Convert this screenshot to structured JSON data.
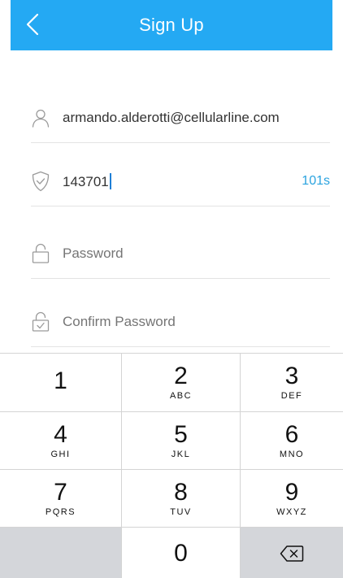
{
  "header": {
    "title": "Sign Up",
    "background": "#24a9f3"
  },
  "form": {
    "email": {
      "value": "armando.alderotti@cellularline.com"
    },
    "code": {
      "value": "143701",
      "timer": "101s",
      "timer_color": "#2aa3df"
    },
    "password": {
      "placeholder": "Password"
    },
    "confirm_password": {
      "placeholder": "Confirm Password"
    }
  },
  "keypad": {
    "keys": [
      {
        "digit": "1",
        "letters": ""
      },
      {
        "digit": "2",
        "letters": "ABC"
      },
      {
        "digit": "3",
        "letters": "DEF"
      },
      {
        "digit": "4",
        "letters": "GHI"
      },
      {
        "digit": "5",
        "letters": "JKL"
      },
      {
        "digit": "6",
        "letters": "MNO"
      },
      {
        "digit": "7",
        "letters": "PQRS"
      },
      {
        "digit": "8",
        "letters": "TUV"
      },
      {
        "digit": "9",
        "letters": "WXYZ"
      },
      {
        "digit": "0",
        "letters": ""
      }
    ]
  },
  "icons": {
    "back": "chevron-left-icon",
    "user": "user-icon",
    "shield": "shield-check-icon",
    "lock": "lock-icon",
    "lock_confirm": "lock-check-icon",
    "delete": "backspace-icon"
  }
}
